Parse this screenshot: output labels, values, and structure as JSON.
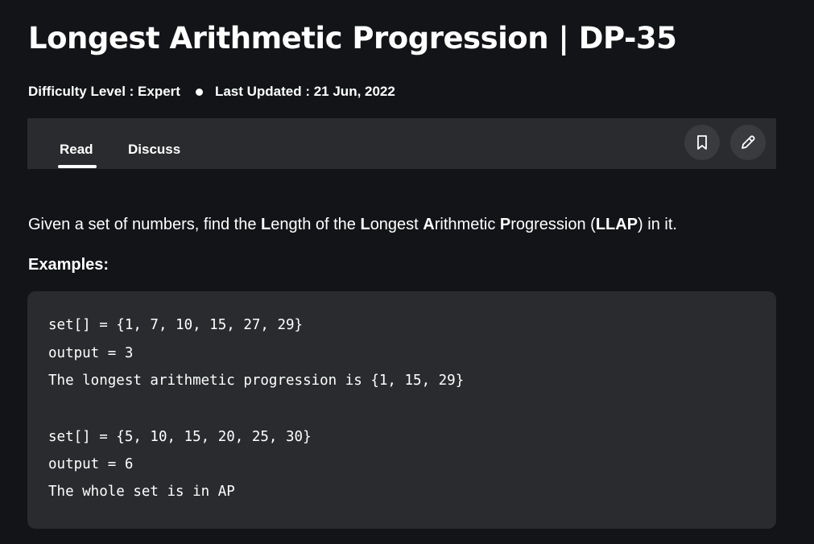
{
  "article": {
    "title": "Longest Arithmetic Progression | DP-35",
    "difficulty": "Difficulty Level : Expert",
    "last_updated": "Last Updated : 21 Jun, 2022"
  },
  "tabs": {
    "read": "Read",
    "discuss": "Discuss"
  },
  "icons": {
    "bookmark": "bookmark-icon",
    "edit": "pencil-icon"
  },
  "intro": {
    "p1": "Given a set of numbers, find the ",
    "L1": "L",
    "p2": "ength of the ",
    "L2": "L",
    "p3": "ongest ",
    "A": "A",
    "p4": "rithmetic ",
    "P": "P",
    "p5": "rogression (",
    "acronym": "LLAP",
    "p6": ") in it."
  },
  "examples_heading": "Examples:",
  "code": {
    "lines": [
      "set[] = {1, 7, 10, 15, 27, 29}",
      "output = 3",
      "The longest arithmetic progression is {1, 15, 29}",
      "set[] = {5, 10, 15, 20, 25, 30}",
      "output = 6",
      "The whole set is in AP"
    ]
  },
  "colors": {
    "background": "#131417",
    "panel": "#2a2b2e",
    "icon_button": "#3a3b3f",
    "text": "#ffffff"
  }
}
